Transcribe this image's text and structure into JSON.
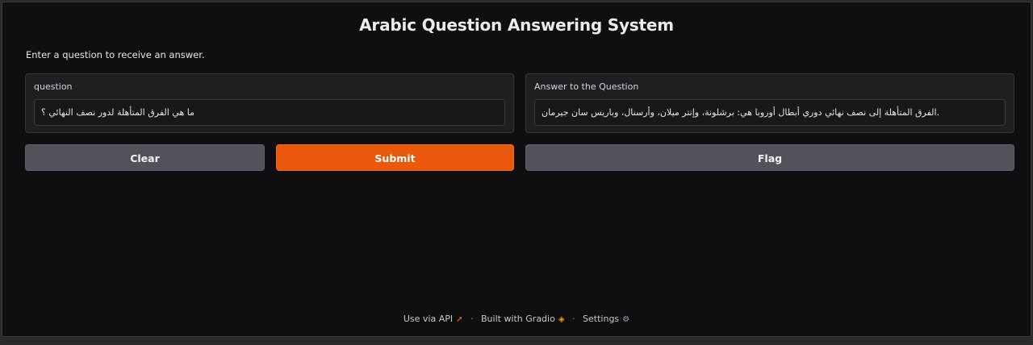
{
  "app": {
    "title": "Arabic Question Answering System",
    "description": "Enter a question to receive an answer."
  },
  "input": {
    "label": "question",
    "value": "ما هي الفرق المتأهلة لدور نصف النهائي ؟"
  },
  "output": {
    "label": "Answer to the Question",
    "value": "الفرق المتأهلة إلى نصف نهائي دوري أبطال أوروبا هي: برشلونة، وإنتر ميلان، وأرسنال، وباريس سان جيرمان."
  },
  "buttons": {
    "clear": "Clear",
    "submit": "Submit",
    "flag": "Flag"
  },
  "footer": {
    "api": "Use via API",
    "built": "Built with Gradio",
    "settings": "Settings",
    "separator": "·"
  },
  "colors": {
    "accent": "#ea580c",
    "background": "#0f0f11",
    "secondary_button": "#52525b"
  },
  "icons": {
    "api": "rocket-icon",
    "gradio": "gradio-logo-icon",
    "settings": "gear-icon"
  }
}
